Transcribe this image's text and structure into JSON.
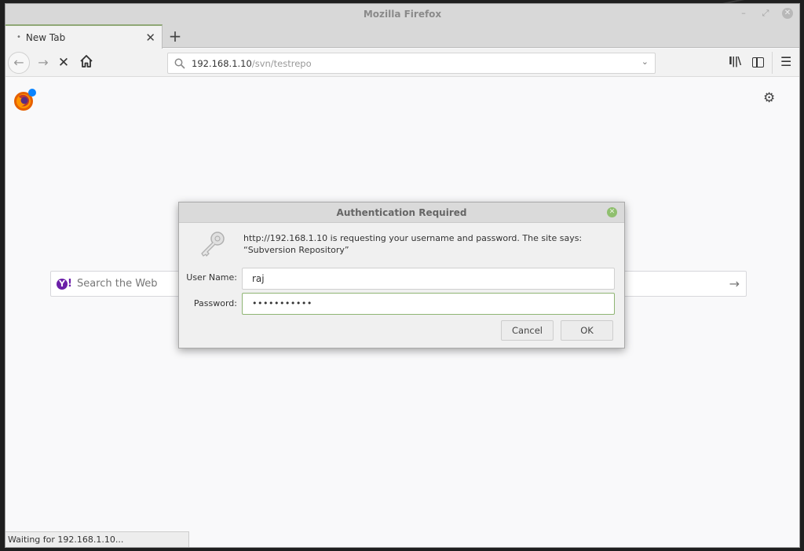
{
  "window": {
    "title": "Mozilla Firefox",
    "controls": {
      "minimize": "–",
      "maximize": "⤢",
      "close": "✕"
    }
  },
  "tabs": [
    {
      "label": "New Tab",
      "loading_indicator": "•",
      "close": "✕"
    }
  ],
  "new_tab_button": "+",
  "navbar": {
    "back": "←",
    "forward": "→",
    "stop": "✕",
    "url_host": "192.168.1.10",
    "url_path": "/svn/testrepo",
    "url_dropdown": "⌄",
    "library": "I||\\",
    "menu": "☰"
  },
  "page": {
    "gear": "⚙",
    "search": {
      "engine_logo": "Y",
      "engine_bang": "!",
      "placeholder": "Search the Web",
      "go": "→"
    }
  },
  "status_bar": {
    "text": "Waiting for 192.168.1.10..."
  },
  "dialog": {
    "title": "Authentication Required",
    "close": "✕",
    "message": "http://192.168.1.10 is requesting your username and password. The site says: “Subversion Repository”",
    "username_label": "User Name:",
    "username_value": "raj",
    "password_label": "Password:",
    "password_value": "•••••••••••",
    "cancel_label": "Cancel",
    "ok_label": "OK"
  }
}
